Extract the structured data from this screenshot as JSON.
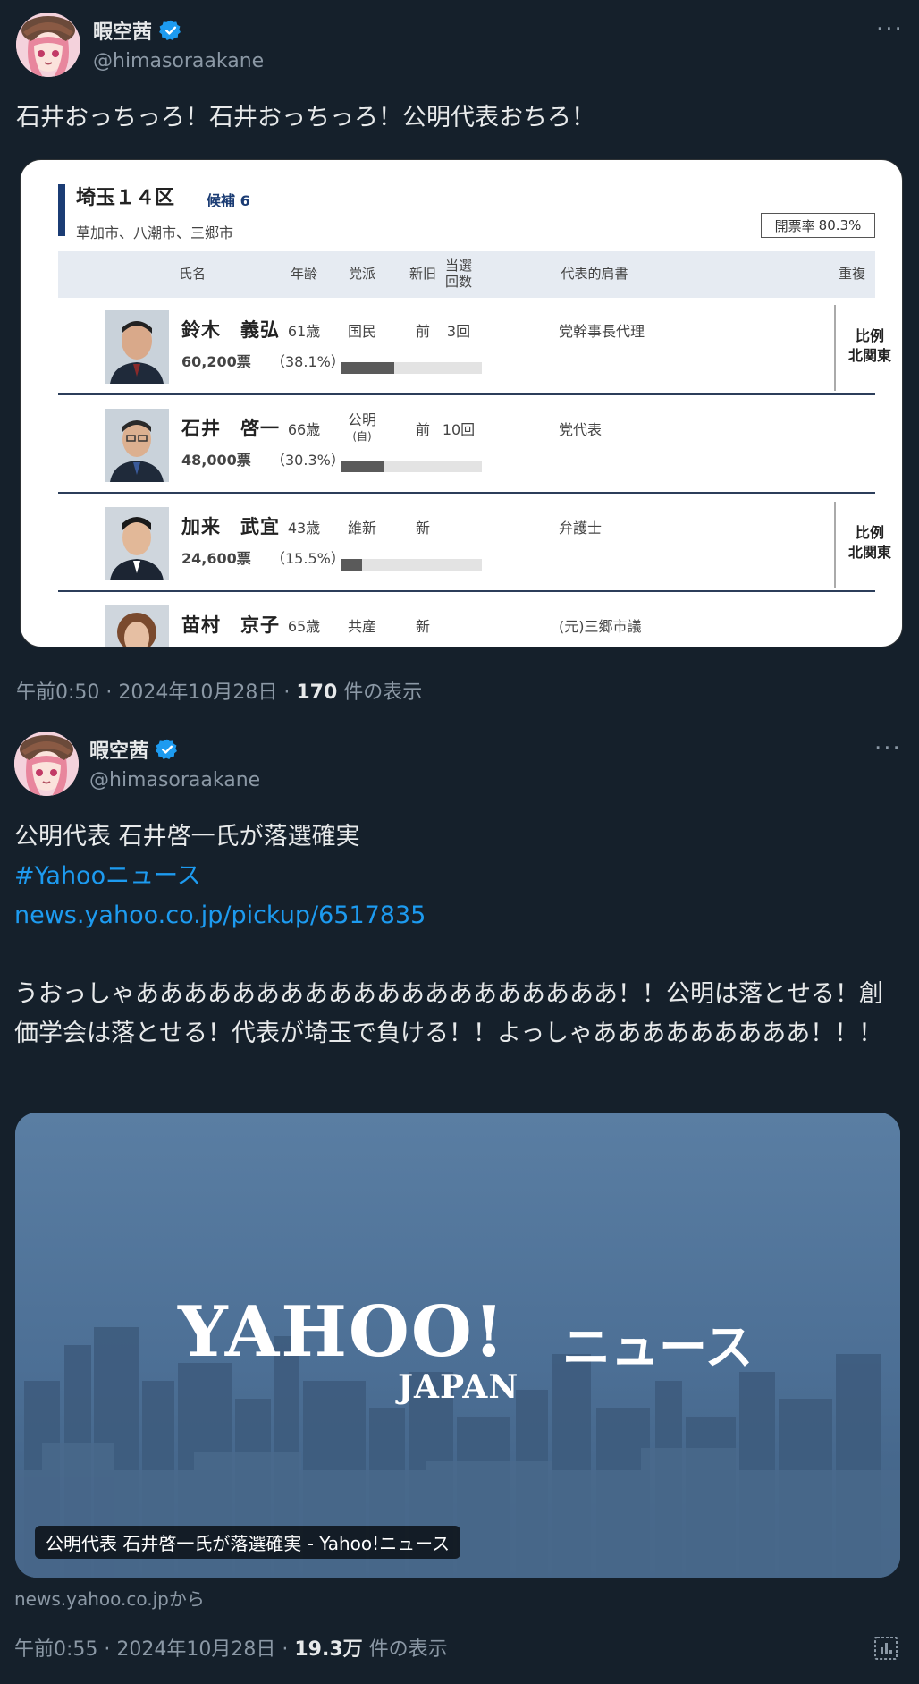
{
  "colors": {
    "background": "#15202b",
    "link": "#1d9bf0",
    "verified": "#1d9bf0",
    "muted": "#8b98a5"
  },
  "tweet1": {
    "display_name": "暇空茜",
    "handle": "@himasoraakane",
    "text": "石井おっちっろ！石井おっちっろ！公明代表おちろ！",
    "time": "午前0:50 · 2024年10月28日 · ",
    "views_count": "170",
    "views_suffix": " 件の表示",
    "card": {
      "district": "埼玉１４区",
      "candidates_label": "候補 6",
      "cities": "草加市、八潮市、三郷市",
      "rate_label": "開票率",
      "rate_value": "80.3%",
      "headers": {
        "name": "氏名",
        "age": "年齢",
        "party": "党派",
        "status": "新旧",
        "wins_1": "当選",
        "wins_2": "回数",
        "title": "代表的肩書",
        "dup": "重複"
      },
      "rows": [
        {
          "name": "鈴木　義弘",
          "votes": "60,200票",
          "pct": "（38.1%）",
          "share": 0.381,
          "age": "61歳",
          "party": "国民",
          "party_sub": "",
          "status": "前",
          "wins": "3回",
          "title": "党幹事長代理",
          "dup_1": "比例",
          "dup_2": "北関東"
        },
        {
          "name": "石井　啓一",
          "votes": "48,000票",
          "pct": "（30.3%）",
          "share": 0.303,
          "age": "66歳",
          "party": "公明",
          "party_sub": "(自)",
          "status": "前",
          "wins": "10回",
          "title": "党代表",
          "dup_1": "",
          "dup_2": ""
        },
        {
          "name": "加来　武宜",
          "votes": "24,600票",
          "pct": "（15.5%）",
          "share": 0.155,
          "age": "43歳",
          "party": "維新",
          "party_sub": "",
          "status": "新",
          "wins": "",
          "title": "弁護士",
          "dup_1": "比例",
          "dup_2": "北関東"
        },
        {
          "name": "苗村　京子",
          "votes": "",
          "pct": "",
          "share": 0,
          "age": "65歳",
          "party": "共産",
          "party_sub": "",
          "status": "新",
          "wins": "",
          "title": "(元)三郷市議",
          "dup_1": "",
          "dup_2": ""
        }
      ]
    }
  },
  "tweet2": {
    "display_name": "暇空茜",
    "handle": "@himasoraakane",
    "line1": "公明代表 石井啓一氏が落選確実",
    "hashtag": "#Yahooニュース",
    "url": "news.yahoo.co.jp/pickup/6517835",
    "body": "うおっしゃああああああああああああああああああああ！！公明は落とせる！創価学会は落とせる！代表が埼玉で負ける！！よっしゃあああああああああ！！！",
    "card": {
      "logo_main": "YAHOO!",
      "logo_sub": "JAPAN",
      "logo_news": "ニュース",
      "caption": "公明代表 石井啓一氏が落選確実 - Yahoo!ニュース"
    },
    "source": "news.yahoo.co.jpから",
    "time": "午前0:55 · 2024年10月28日 · ",
    "views_count": "19.3万",
    "views_suffix": " 件の表示"
  }
}
